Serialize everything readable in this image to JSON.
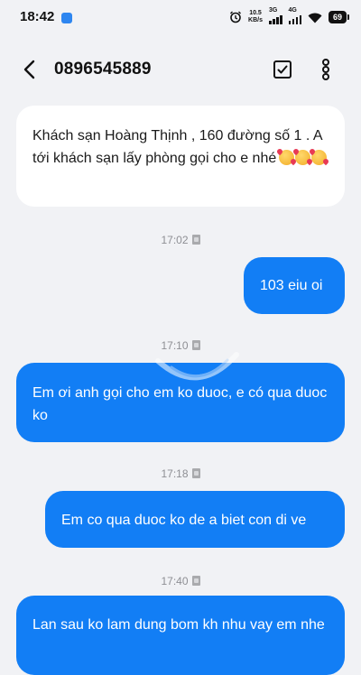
{
  "status_bar": {
    "time": "18:42",
    "net_speed_value": "10.5",
    "net_speed_unit": "KB/s",
    "sim1_label": "3G",
    "sim2_label": "4G",
    "battery": "69"
  },
  "header": {
    "contact": "0896545889"
  },
  "messages": [
    {
      "direction": "incoming",
      "text": "Khách sạn Hoàng Thịnh , 160 đường số 1 . A tới khách sạn lấy phòng gọi cho e nhé"
    },
    {
      "direction": "outgoing",
      "text": "103 eiu oi"
    },
    {
      "direction": "outgoing",
      "text": "Em ơi anh gọi cho em ko duoc, e có qua duoc ko"
    },
    {
      "direction": "outgoing",
      "text": "Em co qua duoc ko de a biet con di ve"
    },
    {
      "direction": "outgoing",
      "text": "Lan sau ko lam dung bom kh nhu vay em nhe"
    }
  ],
  "timestamps": [
    "17:02",
    "17:10",
    "17:18",
    "17:40"
  ],
  "colors": {
    "background": "#f1f2f5",
    "outgoing_bubble": "#127ef5",
    "incoming_bubble": "#ffffff",
    "timestamp_text": "#8e8f94"
  },
  "icons": {
    "back": "arrow-left",
    "select": "checkbox",
    "more": "vertical-dots",
    "sim": "sim-card",
    "emoji": "smiling-face-with-hearts"
  }
}
